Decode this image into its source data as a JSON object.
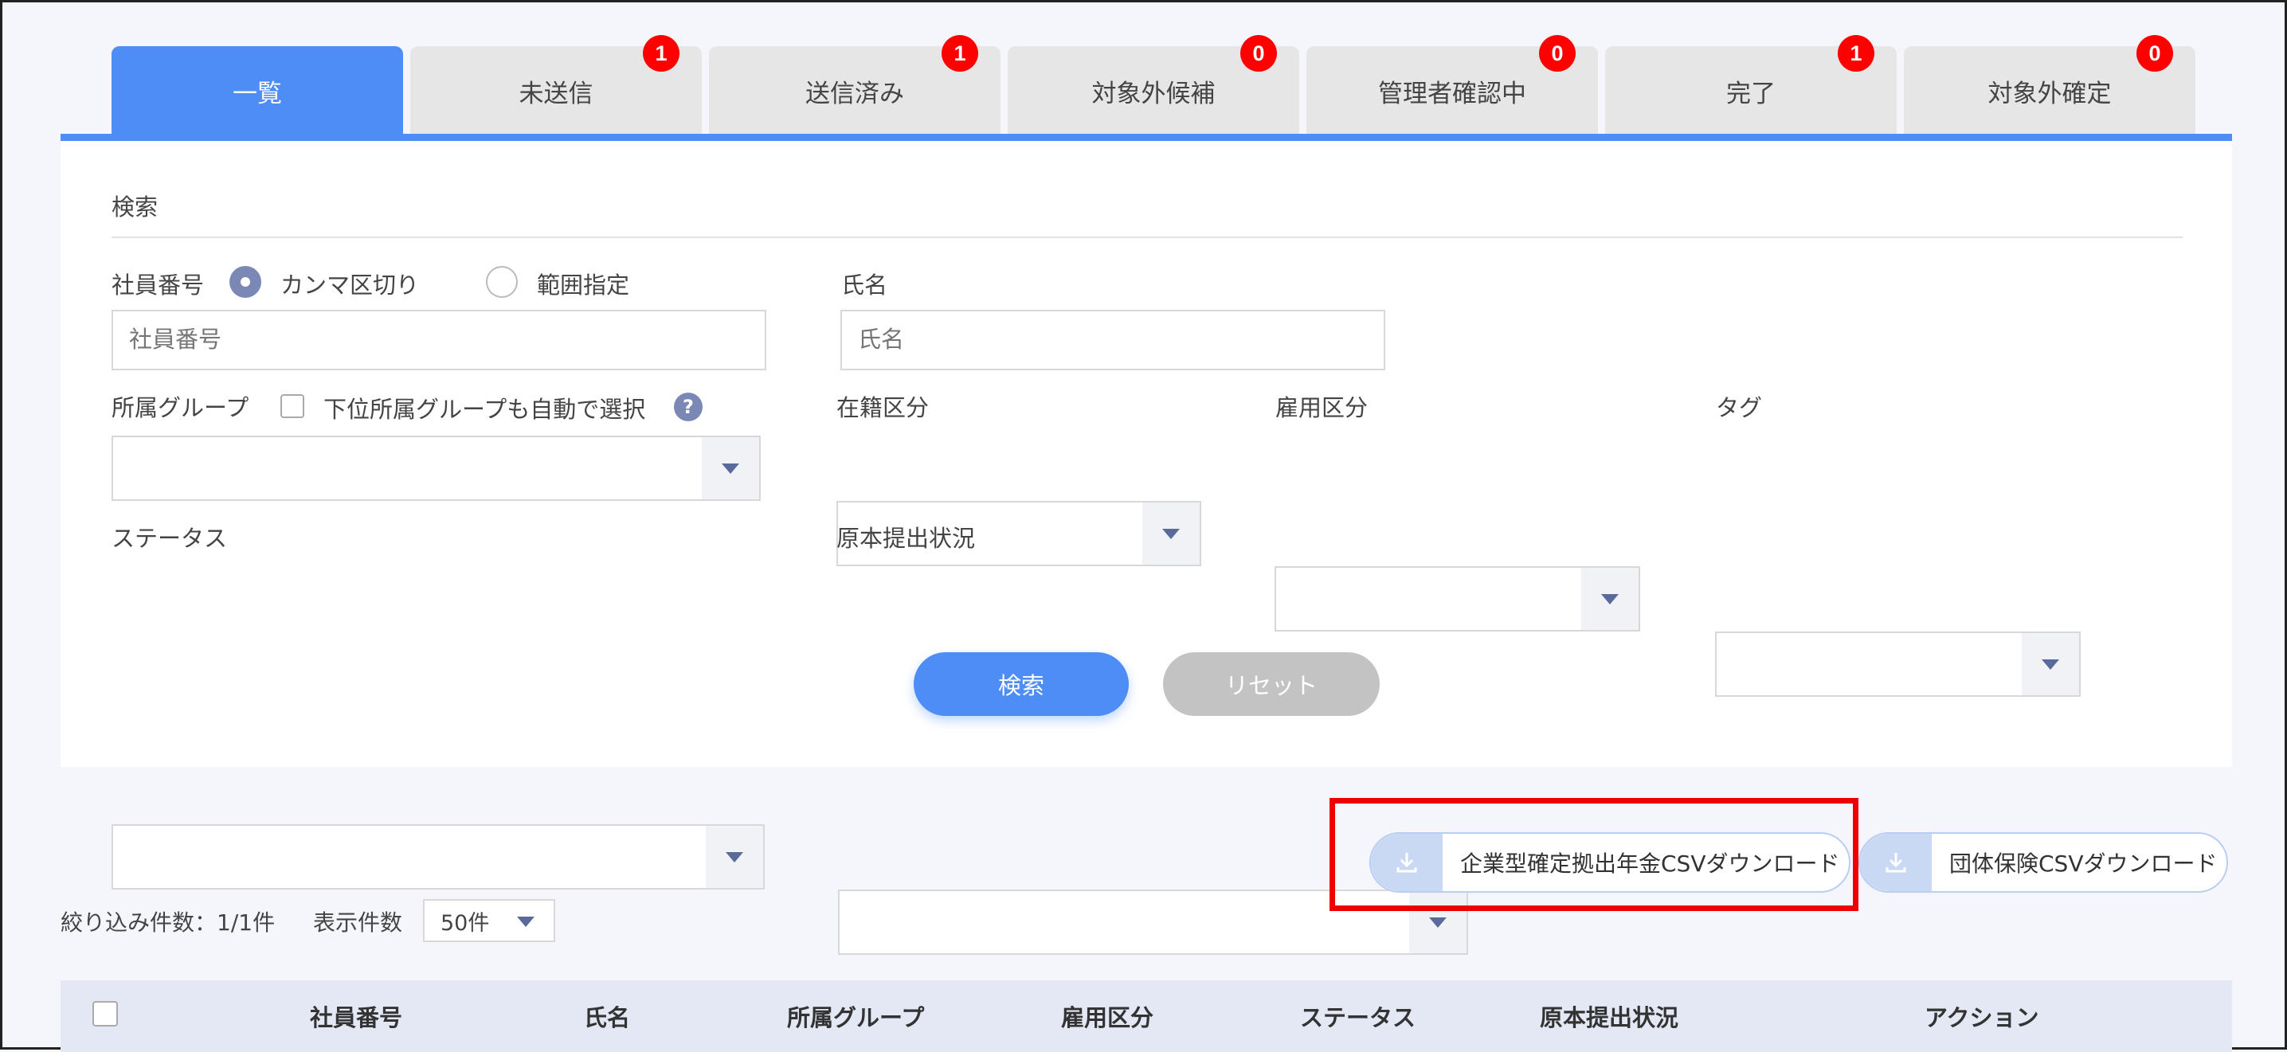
{
  "tabs": [
    {
      "label": "一覧",
      "badge": null,
      "active": true
    },
    {
      "label": "未送信",
      "badge": "1",
      "active": false
    },
    {
      "label": "送信済み",
      "badge": "1",
      "active": false
    },
    {
      "label": "対象外候補",
      "badge": "0",
      "active": false
    },
    {
      "label": "管理者確認中",
      "badge": "0",
      "active": false
    },
    {
      "label": "完了",
      "badge": "1",
      "active": false
    },
    {
      "label": "対象外確定",
      "badge": "0",
      "active": false
    }
  ],
  "search": {
    "title": "検索",
    "employee_no_label": "社員番号",
    "radio_comma": "カンマ区切り",
    "radio_range": "範囲指定",
    "employee_no_placeholder": "社員番号",
    "name_label": "氏名",
    "name_placeholder": "氏名",
    "group_label": "所属グループ",
    "auto_select_sub_label": "下位所属グループも自動で選択",
    "help_glyph": "?",
    "enrollment_label": "在籍区分",
    "employment_label": "雇用区分",
    "tag_label": "タグ",
    "status_label": "ステータス",
    "original_submission_label": "原本提出状況",
    "search_button": "検索",
    "reset_button": "リセット"
  },
  "downloads": {
    "dc_pension_csv": "企業型確定拠出年金CSVダウンロード",
    "group_insurance_csv": "団体保険CSVダウンロード"
  },
  "list": {
    "filter_count": "絞り込み件数：1/1件",
    "per_page_label": "表示件数",
    "per_page_value": "50件"
  },
  "table": {
    "columns": [
      "社員番号",
      "氏名",
      "所属グループ",
      "雇用区分",
      "ステータス",
      "原本提出状況",
      "アクション"
    ]
  },
  "colors": {
    "accent": "#4e8cf6",
    "badge": "#ff0000",
    "highlight": "#ee0000"
  }
}
